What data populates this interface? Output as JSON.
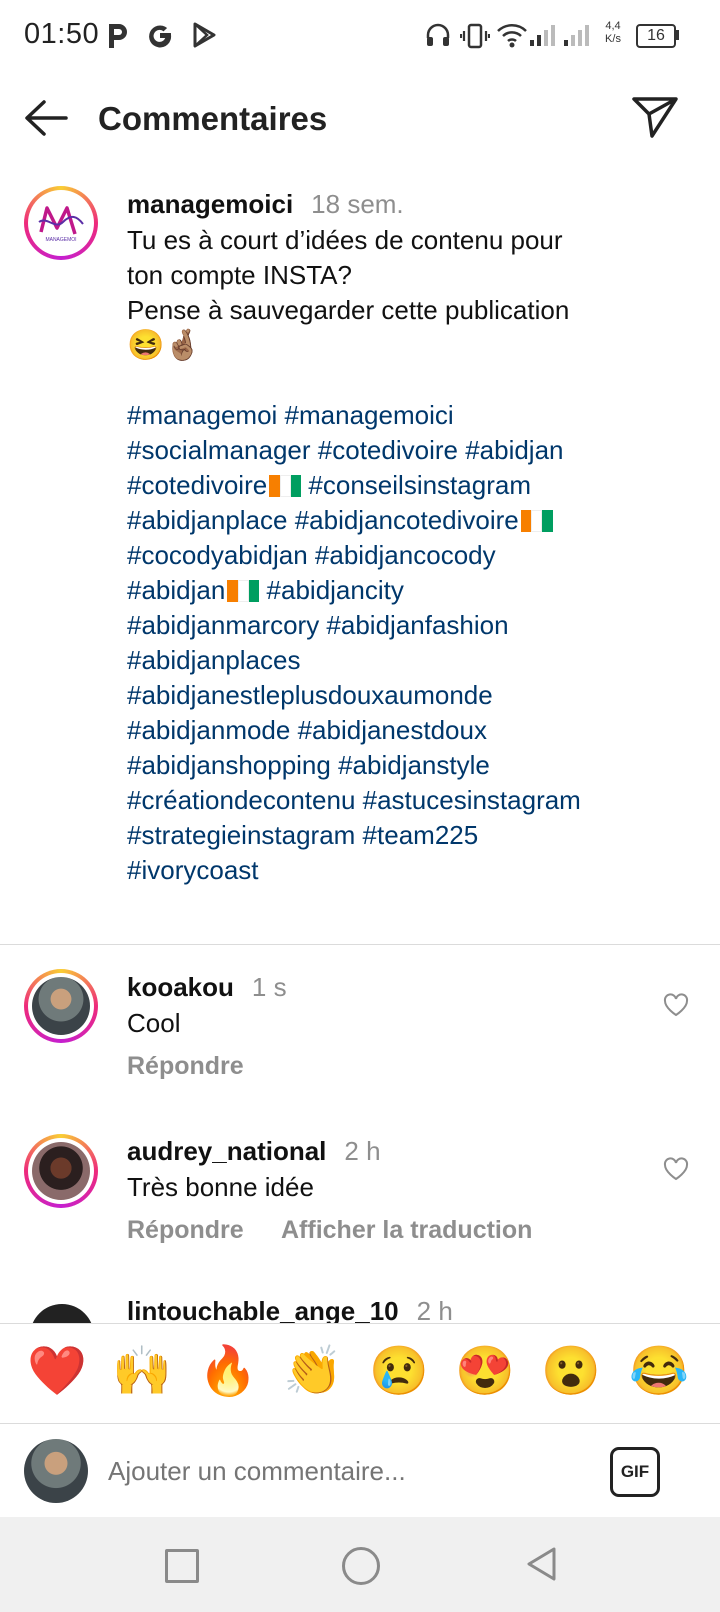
{
  "status_bar": {
    "time": "01:50",
    "net_speed_top": "4,4",
    "net_speed_bottom": "K/s",
    "battery": "16"
  },
  "header": {
    "title": "Commentaires"
  },
  "caption": {
    "username": "managemoici",
    "time": "18 sem.",
    "lines": [
      "Tu es à court d’idées de contenu pour",
      "ton compte INSTA?",
      "Pense à sauvegarder cette publication"
    ],
    "emoji_line": "😆🤞🏽",
    "avatar_logo_text": "MANAGEMOI"
  },
  "hashtags": {
    "l1": "#managemoi #managemoici",
    "l2": "#socialmanager #cotedivoire #abidjan",
    "l3a": "#cotedivoire",
    "l3b": " #conseilsinstagram",
    "l4a": "#abidjanplace #abidjancotedivoire",
    "l5": "#cocodyabidjan #abidjancocody",
    "l6a": "#abidjan",
    "l6b": " #abidjancity",
    "l7": "#abidjanmarcory #abidjanfashion",
    "l8": "#abidjanplaces",
    "l9": "#abidjanestleplusdouxaumonde",
    "l10": "#abidjanmode #abidjanestdoux",
    "l11": "#abidjanshopping #abidjanstyle",
    "l12": "#créationdecontenu #astucesinstagram",
    "l13": "#strategieinstagram #team225",
    "l14": "#ivorycoast"
  },
  "comments": [
    {
      "username": "kooakou",
      "time": "1 s",
      "text": "Cool",
      "reply": "Répondre"
    },
    {
      "username": "audrey_national",
      "time": "2 h",
      "text": "Très bonne idée",
      "reply": "Répondre",
      "translate": "Afficher la traduction"
    },
    {
      "username": "lintouchable_ange_10",
      "time": "2 h"
    }
  ],
  "emoji_bar": [
    "❤️",
    "🙌",
    "🔥",
    "👏",
    "😢",
    "😍",
    "😮",
    "😂"
  ],
  "input": {
    "placeholder": "Ajouter un commentaire...",
    "gif_label": "GIF"
  },
  "colors": {
    "hashtag": "#00376b",
    "muted": "#8e8e8e",
    "divider": "#dbdbdb"
  }
}
